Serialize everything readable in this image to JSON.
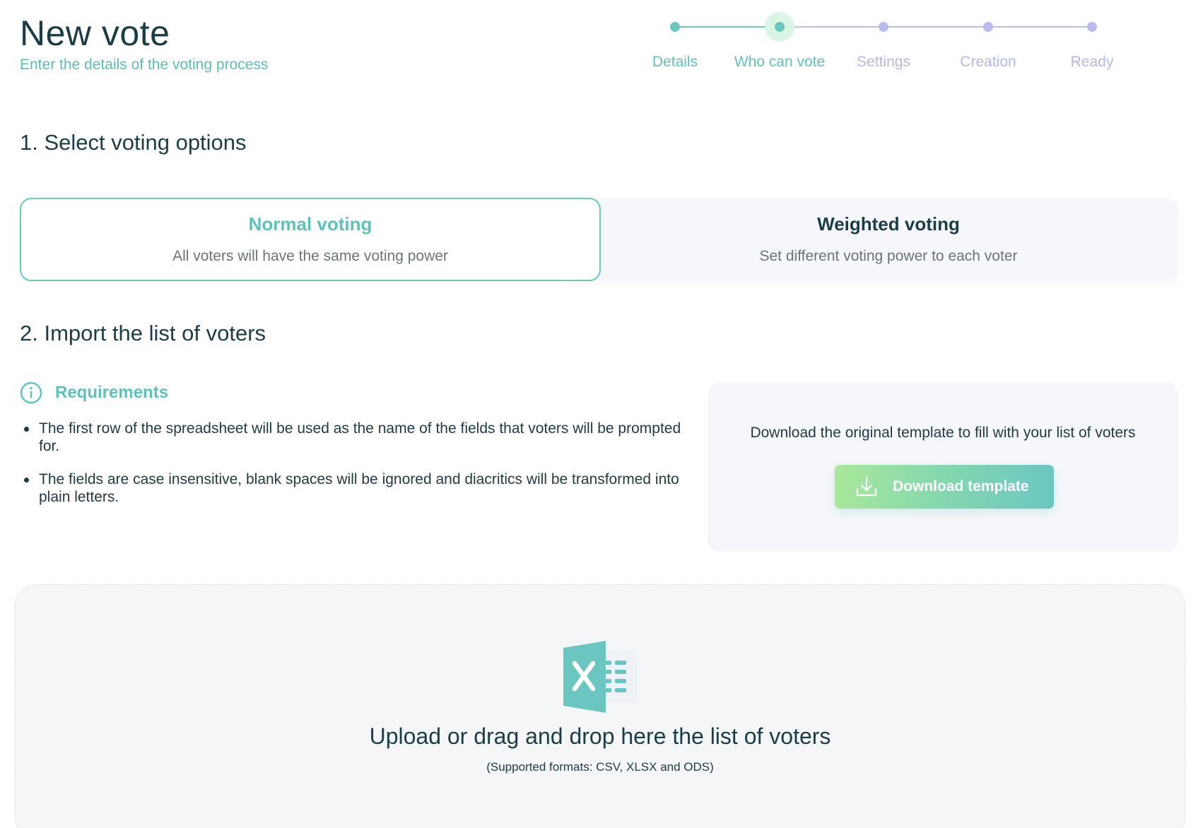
{
  "header": {
    "title": "New vote",
    "subtitle": "Enter the details of the voting process"
  },
  "stepper": {
    "current_step": 2,
    "steps": [
      {
        "label": "Details",
        "state": "done"
      },
      {
        "label": "Who can vote",
        "state": "current"
      },
      {
        "label": "Settings",
        "state": "upcoming"
      },
      {
        "label": "Creation",
        "state": "upcoming"
      },
      {
        "label": "Ready",
        "state": "upcoming"
      }
    ],
    "colors": {
      "done": "#6bc6bf",
      "upcoming": "#b8bdee",
      "halo": "#d9f5e4"
    }
  },
  "section1": {
    "title": "1. Select voting options",
    "options": [
      {
        "title": "Normal voting",
        "description": "All voters will have the same voting power",
        "selected": true
      },
      {
        "title": "Weighted voting",
        "description": "Set different voting power to each voter",
        "selected": false
      }
    ]
  },
  "section2": {
    "title": "2. Import the list of voters",
    "requirements": {
      "icon": "info-icon",
      "title": "Requirements",
      "items": [
        "The first row of the spreadsheet will be used as the name of the fields that voters will be prompted for.",
        "The fields are case insensitive, blank spaces will be ignored and diacritics will be transformed into plain letters."
      ]
    },
    "template": {
      "text": "Download the original template to fill with your list of voters",
      "button_label": "Download template",
      "button_icon": "download-icon"
    },
    "dropzone": {
      "icon": "spreadsheet-file-icon",
      "text": "Upload or drag and drop here the list of voters",
      "formats": "(Supported formats: CSV, XLSX and ODS)"
    }
  },
  "colors": {
    "accent": "#5fc2ba",
    "text_dark": "#1b3d47",
    "muted": "#6a7479",
    "panel_bg": "#f6f7fa"
  }
}
